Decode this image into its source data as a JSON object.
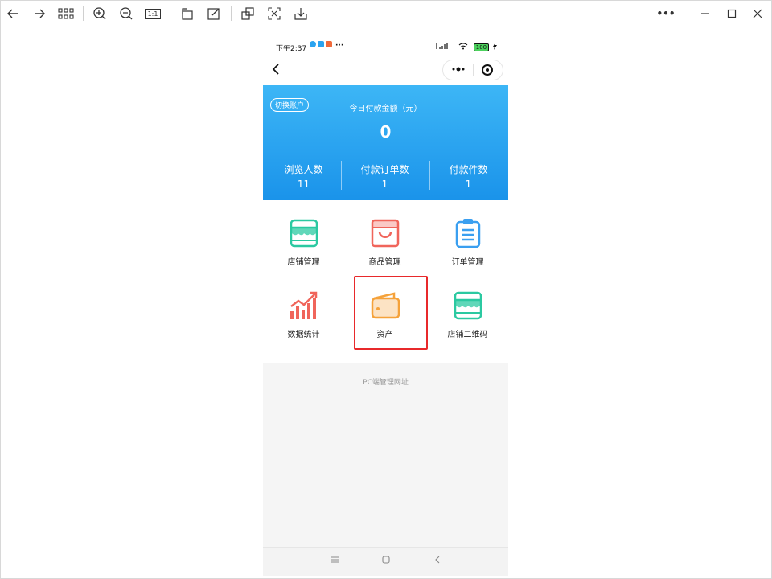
{
  "viewer_toolbar": {
    "icons": [
      "arrow-left-icon",
      "arrow-right-icon",
      "grid-icon",
      "zoom-in-icon",
      "zoom-out-icon",
      "actual-size-icon",
      "rotate-icon",
      "edit-icon",
      "crop-icon",
      "fit-icon",
      "download-icon"
    ],
    "actual_size_label": "1:1",
    "more_label": "•••"
  },
  "status_bar": {
    "time": "下午2:37",
    "battery": "100"
  },
  "banner": {
    "switch_account": "切换账户",
    "today_payment_label": "今日付款金额（元）",
    "today_payment_value": "0",
    "stats": [
      {
        "label": "浏览人数",
        "value": "11"
      },
      {
        "label": "付款订单数",
        "value": "1"
      },
      {
        "label": "付款件数",
        "value": "1"
      }
    ]
  },
  "menu": [
    {
      "label": "店铺管理",
      "icon": "store-icon"
    },
    {
      "label": "商品管理",
      "icon": "shopping-bag-icon"
    },
    {
      "label": "订单管理",
      "icon": "clipboard-icon"
    },
    {
      "label": "数据统计",
      "icon": "chart-icon"
    },
    {
      "label": "资产",
      "icon": "wallet-icon"
    },
    {
      "label": "店铺二维码",
      "icon": "store-qr-icon"
    }
  ],
  "pc_link": "PC端管理网址",
  "colors": {
    "banner_top": "#3db6f6",
    "banner_bottom": "#1a93ea",
    "highlight": "#e8292b",
    "green": "#2bc9a1",
    "red": "#f0655b",
    "blue": "#3a9ff0",
    "orange": "#f5a23a"
  }
}
